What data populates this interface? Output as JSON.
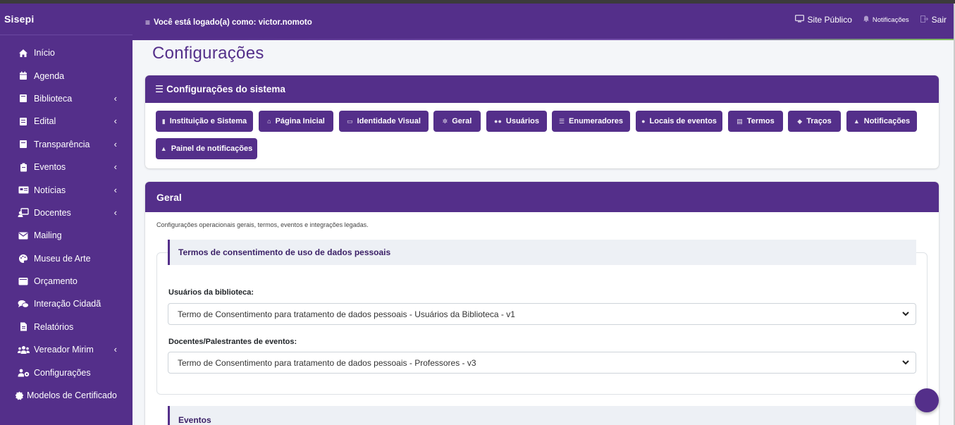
{
  "app": {
    "brand": "Sisepi"
  },
  "topbar": {
    "logged_in": "Você está logado(a) como: victor.nomoto",
    "site_publico": "Site Público",
    "notificacoes": "Notificações",
    "sair": "Sair"
  },
  "sidebar": {
    "items": [
      {
        "label": "Início",
        "icon": "home-icon",
        "chevron": false
      },
      {
        "label": "Agenda",
        "icon": "calendar-icon",
        "chevron": false
      },
      {
        "label": "Biblioteca",
        "icon": "book-icon",
        "chevron": true
      },
      {
        "label": "Edital",
        "icon": "document-icon",
        "chevron": true
      },
      {
        "label": "Transparência",
        "icon": "document-icon",
        "chevron": true
      },
      {
        "label": "Eventos",
        "icon": "clipboard-icon",
        "chevron": true
      },
      {
        "label": "Notícias",
        "icon": "newspaper-icon",
        "chevron": true
      },
      {
        "label": "Docentes",
        "icon": "teacher-icon",
        "chevron": true
      },
      {
        "label": "Mailing",
        "icon": "envelope-icon",
        "chevron": false
      },
      {
        "label": "Museu de Arte",
        "icon": "palette-icon",
        "chevron": false
      },
      {
        "label": "Orçamento",
        "icon": "wallet-icon",
        "chevron": false
      },
      {
        "label": "Interação Cidadã",
        "icon": "comments-icon",
        "chevron": false
      },
      {
        "label": "Relatórios",
        "icon": "report-icon",
        "chevron": false
      },
      {
        "label": "Vereador Mirim",
        "icon": "users-icon",
        "chevron": true
      },
      {
        "label": "Configurações",
        "icon": "users-cog-icon",
        "chevron": false
      },
      {
        "label": "Modelos de Certificado",
        "icon": "certificate-icon",
        "chevron": false
      }
    ]
  },
  "main": {
    "page_title": "Configurações",
    "system_card": {
      "title": "Configurações do sistema",
      "buttons": [
        "Instituição e Sistema",
        "Página Inicial",
        "Identidade Visual",
        "Geral",
        "Usuários",
        "Enumeradores",
        "Locais de eventos",
        "Termos",
        "Traços",
        "Notificações",
        "Painel de notificações"
      ]
    },
    "geral_card": {
      "title": "Geral",
      "description": "Configurações operacionais gerais, termos, eventos e integrações legadas.",
      "terms_section": {
        "title": "Termos de consentimento de uso de dados pessoais",
        "library_label": "Usuários da biblioteca:",
        "library_value": "Termo de Consentimento para tratamento de dados pessoais - Usuários da Biblioteca - v1",
        "teachers_label": "Docentes/Palestrantes de eventos:",
        "teachers_value": "Termo de Consentimento para tratamento de dados pessoais - Professores - v3"
      },
      "events_section": {
        "title": "Eventos"
      }
    }
  },
  "colors": {
    "primary": "#542f8a",
    "section_bg": "#edf0f5",
    "page_bg": "#f4f6f9"
  }
}
